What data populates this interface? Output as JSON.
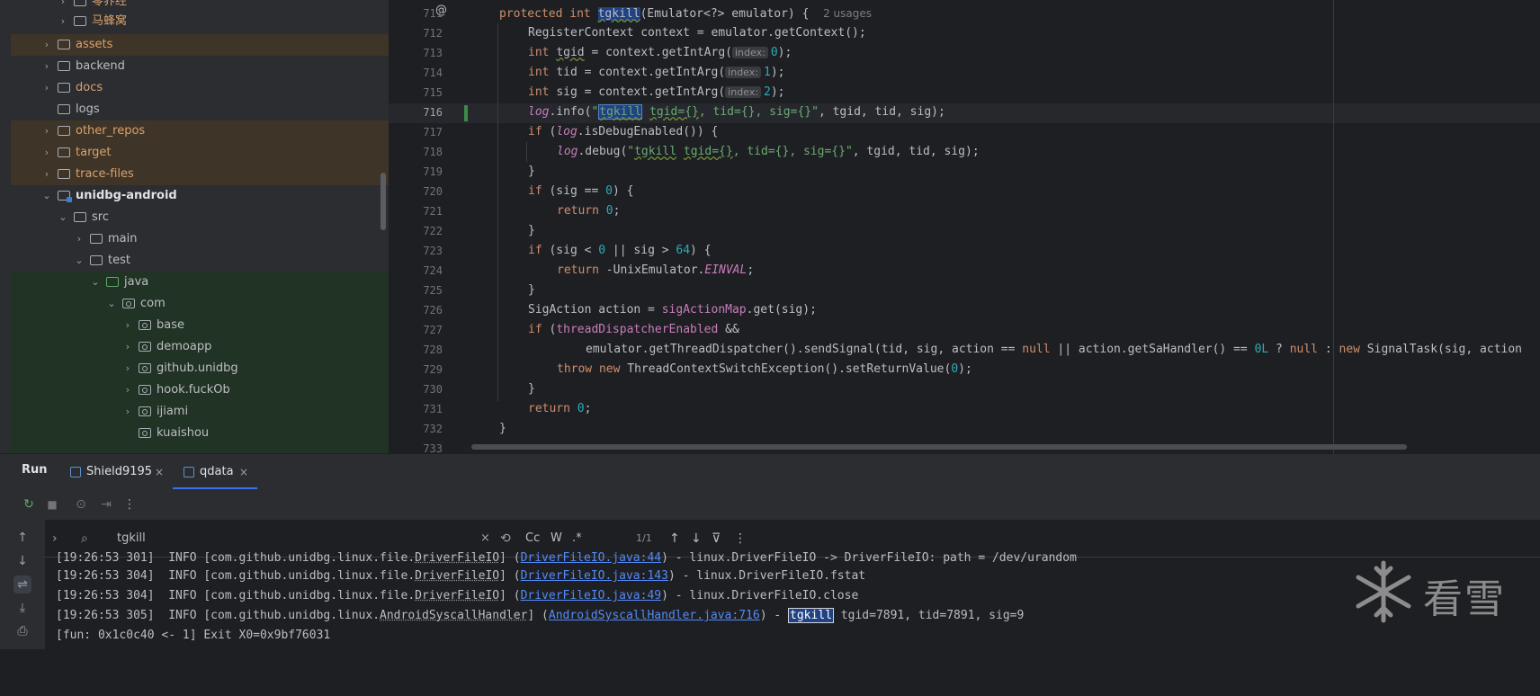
{
  "tree": {
    "items": [
      {
        "label": "零界经",
        "chevron": "›"
      },
      {
        "label": "马蜂窝",
        "chevron": "›"
      },
      {
        "label": "assets",
        "chevron": "›"
      },
      {
        "label": "backend",
        "chevron": "›"
      },
      {
        "label": "docs",
        "chevron": "›"
      },
      {
        "label": "logs",
        "chevron": ""
      },
      {
        "label": "other_repos",
        "chevron": "›"
      },
      {
        "label": "target",
        "chevron": "›"
      },
      {
        "label": "trace-files",
        "chevron": "›"
      },
      {
        "label": "unidbg-android",
        "chevron": "⌄"
      },
      {
        "label": "src",
        "chevron": "⌄"
      },
      {
        "label": "main",
        "chevron": "›"
      },
      {
        "label": "test",
        "chevron": "⌄"
      },
      {
        "label": "java",
        "chevron": "⌄"
      },
      {
        "label": "com",
        "chevron": "⌄"
      },
      {
        "label": "base",
        "chevron": "›"
      },
      {
        "label": "demoapp",
        "chevron": "›"
      },
      {
        "label": "github.unidbg",
        "chevron": "›"
      },
      {
        "label": "hook.fuckOb",
        "chevron": "›"
      },
      {
        "label": "ijiami",
        "chevron": "›"
      },
      {
        "label": "kuaishou",
        "chevron": ""
      }
    ]
  },
  "editor": {
    "annotation_icon": "@",
    "usages": "2 usages",
    "line_numbers": [
      "711",
      "712",
      "713",
      "714",
      "715",
      "716",
      "717",
      "718",
      "719",
      "720",
      "721",
      "722",
      "723",
      "724",
      "725",
      "726",
      "727",
      "728",
      "729",
      "730",
      "731",
      "732",
      "733"
    ],
    "current_line": "716",
    "t": {
      "protected": "protected",
      "int": "int",
      "tgkill": "tgkill",
      "sig711": "(Emulator<?> emulator) {",
      "l712": "RegisterContext context = emulator.getContext();",
      "tgid": "tgid",
      "tid": "tid",
      "sig": "sig",
      "eqctx": " = context.getIntArg(",
      "index": "index:",
      "n0": "0",
      "n1": "1",
      "n2": "2",
      "close": ");",
      "log": "log",
      ".info": ".info(",
      "q": "\"",
      "tgkill_s": "tgkill",
      "tgid_s": "tgid={}",
      "rest_s": ", tid={}, sig={}",
      "args": ", tgid, tid, sig);",
      "if": "if",
      "l717": " (",
      ".isDebugEnabled": ".isDebugEnabled()) {",
      ".debug": ".debug(",
      "rb": "}",
      "l720": " (sig == ",
      "l720b": ") {",
      "return": "return",
      "zero": "0",
      "semi": ";",
      "l723a": " (sig < ",
      "l723b": " || sig > ",
      "n64": "64",
      "l723c": ") {",
      "l724": " -UnixEmulator.",
      "EINVAL": "EINVAL",
      "l726a": "SigAction action = ",
      "sigActionMap": "sigActionMap",
      "l726b": ".get(sig);",
      "threadDispatcherEnabled": "threadDispatcherEnabled",
      "amp": " &&",
      "l728a": "emulator.getThreadDispatcher().sendSignal(tid, sig, action == ",
      "null": "null",
      "l728b": " || action.getSaHandler() == ",
      "zeroL": "0L",
      "l728c": " ? ",
      "l728d": " : ",
      "new": "new",
      "l728e": " SignalTask(sig, action",
      "throw": "throw",
      "l729": " ThreadContextSwitchException().setReturnValue(",
      "l729b": ");",
      "l731": ";"
    }
  },
  "run": {
    "title": "Run",
    "tabs": [
      {
        "label": "Shield9195",
        "close": "×"
      },
      {
        "label": "qdata",
        "close": "×"
      }
    ]
  },
  "toolbar": {
    "rerun": "↻",
    "stop": "■",
    "camera": "⊙",
    "exit": "⇥",
    "more": "⋮"
  },
  "left_strip": {
    "up": "↑",
    "down": "↓",
    "wrap": "⇌",
    "export": "⤓",
    "print": "⎙"
  },
  "search": {
    "expand": "›",
    "icon": "⌕",
    "query": "tgkill",
    "clear": "×",
    "regex_flip": "⟲",
    "cc": "Cc",
    "w": "W",
    "regex": ".*",
    "count": "1/1",
    "prev": "↑",
    "next": "↓",
    "filter": "⊽",
    "more": "⋮"
  },
  "console": {
    "lines": [
      {
        "pre": "[19:26:53 301]  INFO [com.github.unidbg.linux.file.",
        "cls": "DriverFileIO",
        "mid": "] (",
        "link": "DriverFileIO.java:44",
        "post": ") - linux.DriverFileIO -> DriverFileIO: path = /dev/urandom"
      },
      {
        "pre": "[19:26:53 304]  INFO [com.github.unidbg.linux.file.",
        "cls": "DriverFileIO",
        "mid": "] (",
        "link": "DriverFileIO.java:143",
        "post": ") - linux.DriverFileIO.fstat"
      },
      {
        "pre": "[19:26:53 304]  INFO [com.github.unidbg.linux.file.",
        "cls": "DriverFileIO",
        "mid": "] (",
        "link": "DriverFileIO.java:49",
        "post": ") - linux.DriverFileIO.close"
      },
      {
        "pre": "[19:26:53 305]  INFO [com.github.unidbg.linux.",
        "cls": "AndroidSyscallHandler",
        "mid": "] (",
        "link": "AndroidSyscallHandler.java:716",
        "post": ") - ",
        "match": "tgkill",
        "tail": " tgid=7891, tid=7891, sig=9"
      },
      {
        "pre": "[fun: 0x1c0c40 <- 1] Exit X0=0x9bf76031"
      }
    ]
  },
  "watermark": {
    "text": "看雪",
    "icon": "snowflake-icon"
  },
  "colors": {
    "accent": "#3574f0",
    "ignored": "#d9a16e",
    "keyword": "#cf8e6d",
    "number": "#2aacb8",
    "string": "#6aab73",
    "field": "#c77dbb",
    "link": "#548af7"
  }
}
